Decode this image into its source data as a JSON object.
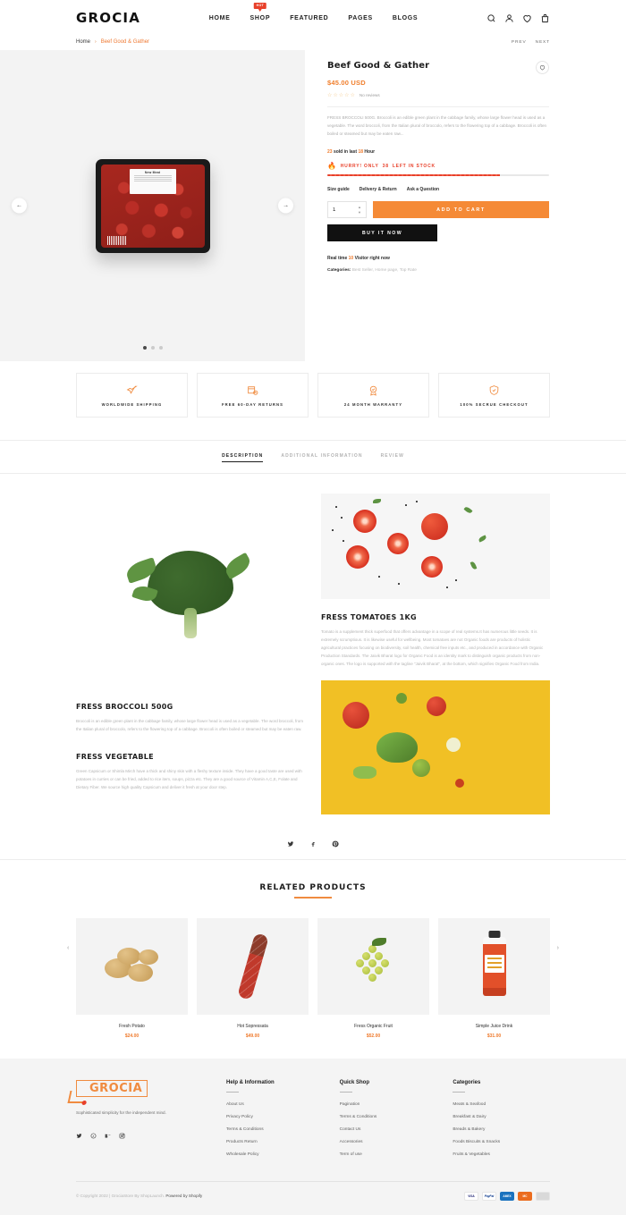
{
  "header": {
    "logo": "GROCIA",
    "nav": [
      {
        "label": "HOME",
        "badge": ""
      },
      {
        "label": "SHOP",
        "badge": "HOT"
      },
      {
        "label": "FEATURED",
        "badge": ""
      },
      {
        "label": "PAGES",
        "badge": ""
      },
      {
        "label": "BLOGS",
        "badge": ""
      }
    ],
    "icons": [
      "search-icon",
      "account-icon",
      "wishlist-icon",
      "cart-icon"
    ]
  },
  "breadcrumb": {
    "home": "Home",
    "separator": "›",
    "current": "Beef Good & Gather",
    "prev": "PREV",
    "next": "NEXT"
  },
  "product": {
    "title": "Beef Good & Gather",
    "price": "$45.00 USD",
    "stars": "☆☆☆☆☆",
    "reviews": "No reviews",
    "description": "FRESS BROCCOLI 500G. Broccoli is an edible green plant in the cabbage family, whose large flower head is used as a vegetable. The word broccoli, from the Italian plural of broccolo, refers to the flowering top of a cabbage. Broccoli is often boiled or steamed but may be eaten raw...",
    "sold_count": "23",
    "sold_text": "sold in last",
    "sold_hours": "18",
    "sold_unit": "Hour",
    "hurry_prefix": "HURRY! ONLY",
    "stock_left": "38",
    "hurry_suffix": "LEFT IN STOCK",
    "links": [
      "Size guide",
      "Delivery & Return",
      "Ask a Question"
    ],
    "quantity": "1",
    "add_to_cart": "ADD TO CART",
    "buy_it_now": "BUY IT NOW",
    "realtime_prefix": "Real time",
    "visitors": "10",
    "realtime_suffix": "Visitor right now",
    "categories_label": "Categories:",
    "categories": "Best Seller, Home page, Top Rate",
    "gallery_dots": 3,
    "pack_label_title": "New Meat",
    "pack_label_top": "100% WITHOUT"
  },
  "trust": [
    {
      "icon": "airplane-icon",
      "label": "WORLDWIDE SHIPPING"
    },
    {
      "icon": "return-box-icon",
      "label": "FREE 60-DAY RETURNS"
    },
    {
      "icon": "warranty-badge-icon",
      "label": "24 MONTH WARRANTY"
    },
    {
      "icon": "shield-check-icon",
      "label": "100% SECRUE CHECKOUT"
    }
  ],
  "tabs": [
    {
      "label": "DESCRIPTION",
      "active": true
    },
    {
      "label": "ADDITIONAL INFORMATION",
      "active": false
    },
    {
      "label": "REVIEW",
      "active": false
    }
  ],
  "description_blocks": {
    "broccoli_heading": "FRESS BROCCOLI 500G",
    "broccoli_text": "Broccoli is an edible green plant in the cabbage family, whose large flower head is used as a vegetable. The word broccoli, from the Italian plural of broccolo, refers to the flowering top of a cabbage. Broccoli is often boiled or steamed but may be eaten raw.",
    "vegetable_heading": "FRESS VEGETABLE",
    "vegetable_text": "Green Capsicum or Shimla Mirch have a thick and shiny skin with a fleshy texture inside. They have a good taste are used with potatoes in curries or can be fried, added to rice item, soups, pizza etc. They are a good source of Vitamin A,C,E, Folate and Dietary Fiber. We source high quality Capsicum and deliver it fresh at your door step.",
    "tomato_heading": "FRESS TOMATOES 1KG",
    "tomato_text": "Tomato is a supplement thick superfood that offers advantage in a scope of real systems.It has numerous little seeds. It is extremely scrumptious. It is likewise useful for wellbeing. Most tomatoes are not Organic foods are products of holistic agricultural practices focusing on biodiversity, soil health, chemical free inputs etc., and produced in accordance with Organic Production Standards. The Jaivik Bharat logo for Organic Food is an identity mark to distinguish organic products from non-organic ones. The logo is supported with the tagline \"Jaivik Bharat\", at the bottom, which signifies Organic Food from India."
  },
  "share_icons": [
    "twitter-icon",
    "facebook-icon",
    "pinterest-icon"
  ],
  "related": {
    "title": "RELATED PRODUCTS",
    "products": [
      {
        "name": "Fresh Potato",
        "price": "$24.00",
        "art": "potato"
      },
      {
        "name": "Hot Sopressata",
        "price": "$49.00",
        "art": "sopressata"
      },
      {
        "name": "Fress Organic Fruit",
        "price": "$52.00",
        "art": "grapes"
      },
      {
        "name": "Simple Juice Drink",
        "price": "$31.00",
        "art": "juice"
      }
    ]
  },
  "footer": {
    "logo": "GROCIA",
    "tagline": "Sophisticated simplicity for the independent mind.",
    "social": [
      "twitter-icon",
      "pinterest-icon",
      "behance-icon",
      "instagram-icon"
    ],
    "columns": [
      {
        "heading": "Help & Information",
        "links": [
          "About Us",
          "Privacy Policy",
          "Terms & Conditions",
          "Products Return",
          "Wholesale Policy"
        ]
      },
      {
        "heading": "Quick Shop",
        "links": [
          "Pagination",
          "Terms & Conditions",
          "Contact Us",
          "Accessories",
          "Term of use"
        ]
      },
      {
        "heading": "Categories",
        "links": [
          "Meats & Seafood",
          "Breakfast & Dairy",
          "Breads & Bakery",
          "Foods Biscuits & Snacks",
          "Fruits & Vegetables"
        ]
      }
    ],
    "copyright_main": "© Copyright 2022 | GrociaStore By",
    "copyright_brand": "ShopLaunch.",
    "copyright_tail": "Powered by Shopify",
    "payments": [
      "VISA",
      "PayPal",
      "AMEX",
      "MC",
      "Maestro"
    ]
  },
  "colors": {
    "accent": "#f08b3f",
    "price": "#ef7a2c",
    "alert": "#e8402a",
    "dark": "#1c1c1c",
    "muted": "#b4b4b4"
  }
}
